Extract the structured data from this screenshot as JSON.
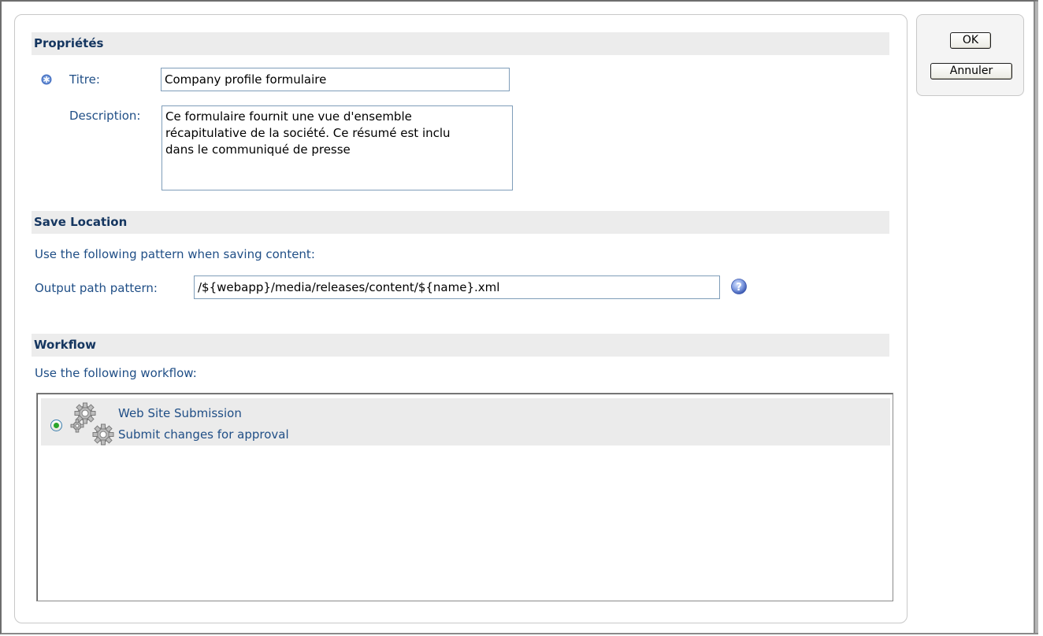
{
  "buttons": {
    "ok": "OK",
    "cancel": "Annuler"
  },
  "properties": {
    "header": "Propriétés",
    "title_label": "Titre:",
    "title_value": "Company profile formulaire",
    "description_label": "Description:",
    "description_value": "Ce formulaire fournit une vue d'ensemble\nrécapitulative de la société. Ce résumé est inclu\ndans le communiqué de presse"
  },
  "save_location": {
    "header": "Save Location",
    "instruction": "Use the following pattern when saving content:",
    "output_label": "Output path pattern:",
    "output_value": "/${webapp}/media/releases/content/${name}.xml"
  },
  "workflow": {
    "header": "Workflow",
    "instruction": "Use the following workflow:",
    "items": [
      {
        "name": "Web Site Submission",
        "description": "Submit changes for approval",
        "selected": true
      }
    ]
  },
  "icons": {
    "required": "required-asterisk-icon",
    "help": "help-icon",
    "workflow": "gears-icon"
  },
  "colors": {
    "label": "#1f4e86",
    "header_text": "#153660",
    "header_bg": "#ececec",
    "help_icon": "#5a78c8"
  }
}
